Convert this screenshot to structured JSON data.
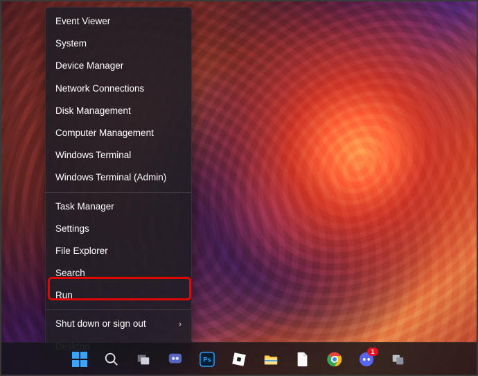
{
  "context_menu": {
    "items_top": [
      "Event Viewer",
      "System",
      "Device Manager",
      "Network Connections",
      "Disk Management",
      "Computer Management",
      "Windows Terminal",
      "Windows Terminal (Admin)"
    ],
    "items_mid": [
      "Task Manager",
      "Settings",
      "File Explorer",
      "Search",
      "Run"
    ],
    "items_bottom": [
      "Shut down or sign out",
      "Desktop"
    ],
    "highlighted_item": "Run"
  },
  "taskbar": {
    "items": [
      "start",
      "search",
      "task-view",
      "chat",
      "photoshop",
      "roblox",
      "file-explorer",
      "document",
      "chrome",
      "discord",
      "app"
    ],
    "discord_badge": "1"
  }
}
